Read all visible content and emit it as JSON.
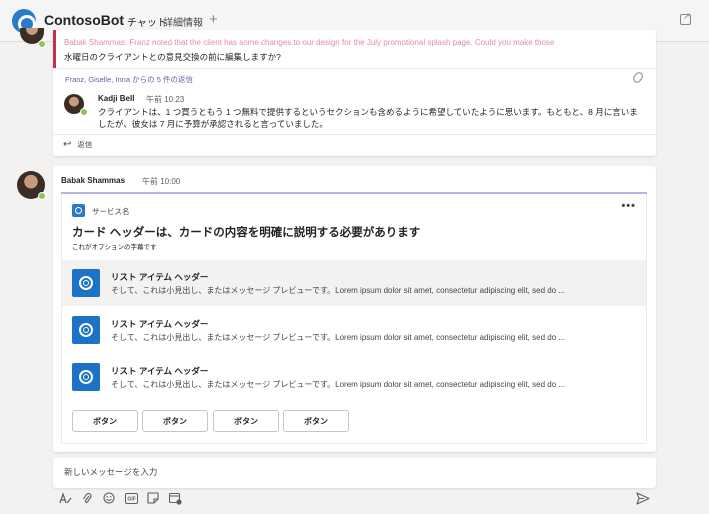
{
  "app": {
    "title": "ContosoBot",
    "tabs": [
      {
        "label": "チャット",
        "active": true
      },
      {
        "label": "詳細情報",
        "active": false
      }
    ],
    "add_tab": "+"
  },
  "thread": {
    "quoted_text": "Babak Shammas: Franz noted that the client has some changes to our design for the July promotional splash page. Could you make those",
    "message": "水曜日のクライアントとの意見交換の前に編集しますか?",
    "replies_link": "Franz, Giselle, Inna からの 5 件の返信",
    "reply": {
      "author": "Kadji Bell",
      "time": "午前 10:23",
      "text": "クライアントは、1 つ買うともう 1 つ無料で提供するというセクションも含めるように希望していたように思います。もともと、8 月に言いましたが、彼女は 7 月に予算が承認されると言っていました。"
    },
    "reply_button": "返信"
  },
  "message": {
    "author": "Babak Shammas",
    "time": "午前 10:00",
    "card": {
      "service_name": "サービス名",
      "more_menu": "•••",
      "title": "カード ヘッダーは、カードの内容を明確に説明する必要があります",
      "subtitle": "これがオプションの字幕です",
      "items": [
        {
          "header": "リスト アイテム ヘッダー",
          "preview": "そして、これは小見出し、またはメッセージ プレビューです。Lorem ipsum dolor sit amet, consectetur adipiscing elit, sed do ..."
        },
        {
          "header": "リスト アイテム ヘッダー",
          "preview": "そして、これは小見出し、またはメッセージ プレビューです。Lorem ipsum dolor sit amet, consectetur adipiscing elit, sed do ..."
        },
        {
          "header": "リスト アイテム ヘッダー",
          "preview": "そして、これは小見出し、またはメッセージ プレビューです。Lorem ipsum dolor sit amet, consectetur adipiscing elit, sed do ..."
        }
      ],
      "buttons": [
        "ボタン",
        "ボタン",
        "ボタン",
        "ボタン"
      ]
    }
  },
  "compose": {
    "placeholder": "新しいメッセージを入力",
    "tools": [
      "format-icon",
      "attach-icon",
      "emoji-icon",
      "gif-icon",
      "sticker-icon",
      "schedule-meeting-icon"
    ],
    "gif_label": "GIF"
  },
  "colors": {
    "accent": "#6264a7",
    "brand_blue": "#2a7ac9",
    "presence": "#92c353",
    "quote_bar": "#c4314b"
  }
}
